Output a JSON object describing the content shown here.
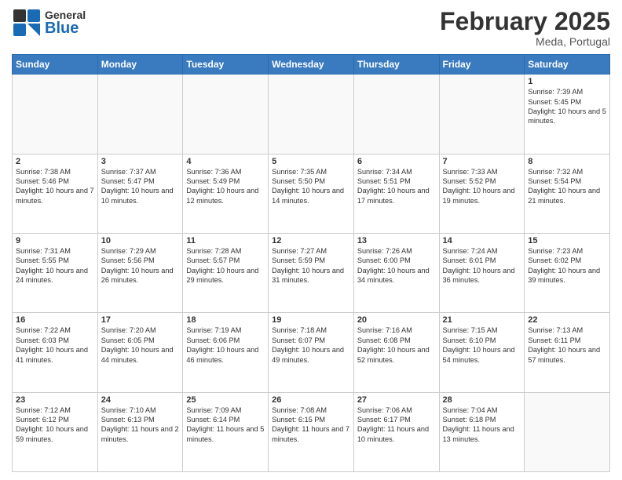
{
  "header": {
    "logo_general": "General",
    "logo_blue": "Blue",
    "month": "February 2025",
    "location": "Meda, Portugal"
  },
  "days_of_week": [
    "Sunday",
    "Monday",
    "Tuesday",
    "Wednesday",
    "Thursday",
    "Friday",
    "Saturday"
  ],
  "weeks": [
    [
      {
        "day": "",
        "info": ""
      },
      {
        "day": "",
        "info": ""
      },
      {
        "day": "",
        "info": ""
      },
      {
        "day": "",
        "info": ""
      },
      {
        "day": "",
        "info": ""
      },
      {
        "day": "",
        "info": ""
      },
      {
        "day": "1",
        "info": "Sunrise: 7:39 AM\nSunset: 5:45 PM\nDaylight: 10 hours and 5 minutes."
      }
    ],
    [
      {
        "day": "2",
        "info": "Sunrise: 7:38 AM\nSunset: 5:46 PM\nDaylight: 10 hours and 7 minutes."
      },
      {
        "day": "3",
        "info": "Sunrise: 7:37 AM\nSunset: 5:47 PM\nDaylight: 10 hours and 10 minutes."
      },
      {
        "day": "4",
        "info": "Sunrise: 7:36 AM\nSunset: 5:49 PM\nDaylight: 10 hours and 12 minutes."
      },
      {
        "day": "5",
        "info": "Sunrise: 7:35 AM\nSunset: 5:50 PM\nDaylight: 10 hours and 14 minutes."
      },
      {
        "day": "6",
        "info": "Sunrise: 7:34 AM\nSunset: 5:51 PM\nDaylight: 10 hours and 17 minutes."
      },
      {
        "day": "7",
        "info": "Sunrise: 7:33 AM\nSunset: 5:52 PM\nDaylight: 10 hours and 19 minutes."
      },
      {
        "day": "8",
        "info": "Sunrise: 7:32 AM\nSunset: 5:54 PM\nDaylight: 10 hours and 21 minutes."
      }
    ],
    [
      {
        "day": "9",
        "info": "Sunrise: 7:31 AM\nSunset: 5:55 PM\nDaylight: 10 hours and 24 minutes."
      },
      {
        "day": "10",
        "info": "Sunrise: 7:29 AM\nSunset: 5:56 PM\nDaylight: 10 hours and 26 minutes."
      },
      {
        "day": "11",
        "info": "Sunrise: 7:28 AM\nSunset: 5:57 PM\nDaylight: 10 hours and 29 minutes."
      },
      {
        "day": "12",
        "info": "Sunrise: 7:27 AM\nSunset: 5:59 PM\nDaylight: 10 hours and 31 minutes."
      },
      {
        "day": "13",
        "info": "Sunrise: 7:26 AM\nSunset: 6:00 PM\nDaylight: 10 hours and 34 minutes."
      },
      {
        "day": "14",
        "info": "Sunrise: 7:24 AM\nSunset: 6:01 PM\nDaylight: 10 hours and 36 minutes."
      },
      {
        "day": "15",
        "info": "Sunrise: 7:23 AM\nSunset: 6:02 PM\nDaylight: 10 hours and 39 minutes."
      }
    ],
    [
      {
        "day": "16",
        "info": "Sunrise: 7:22 AM\nSunset: 6:03 PM\nDaylight: 10 hours and 41 minutes."
      },
      {
        "day": "17",
        "info": "Sunrise: 7:20 AM\nSunset: 6:05 PM\nDaylight: 10 hours and 44 minutes."
      },
      {
        "day": "18",
        "info": "Sunrise: 7:19 AM\nSunset: 6:06 PM\nDaylight: 10 hours and 46 minutes."
      },
      {
        "day": "19",
        "info": "Sunrise: 7:18 AM\nSunset: 6:07 PM\nDaylight: 10 hours and 49 minutes."
      },
      {
        "day": "20",
        "info": "Sunrise: 7:16 AM\nSunset: 6:08 PM\nDaylight: 10 hours and 52 minutes."
      },
      {
        "day": "21",
        "info": "Sunrise: 7:15 AM\nSunset: 6:10 PM\nDaylight: 10 hours and 54 minutes."
      },
      {
        "day": "22",
        "info": "Sunrise: 7:13 AM\nSunset: 6:11 PM\nDaylight: 10 hours and 57 minutes."
      }
    ],
    [
      {
        "day": "23",
        "info": "Sunrise: 7:12 AM\nSunset: 6:12 PM\nDaylight: 10 hours and 59 minutes."
      },
      {
        "day": "24",
        "info": "Sunrise: 7:10 AM\nSunset: 6:13 PM\nDaylight: 11 hours and 2 minutes."
      },
      {
        "day": "25",
        "info": "Sunrise: 7:09 AM\nSunset: 6:14 PM\nDaylight: 11 hours and 5 minutes."
      },
      {
        "day": "26",
        "info": "Sunrise: 7:08 AM\nSunset: 6:15 PM\nDaylight: 11 hours and 7 minutes."
      },
      {
        "day": "27",
        "info": "Sunrise: 7:06 AM\nSunset: 6:17 PM\nDaylight: 11 hours and 10 minutes."
      },
      {
        "day": "28",
        "info": "Sunrise: 7:04 AM\nSunset: 6:18 PM\nDaylight: 11 hours and 13 minutes."
      },
      {
        "day": "",
        "info": ""
      }
    ]
  ]
}
